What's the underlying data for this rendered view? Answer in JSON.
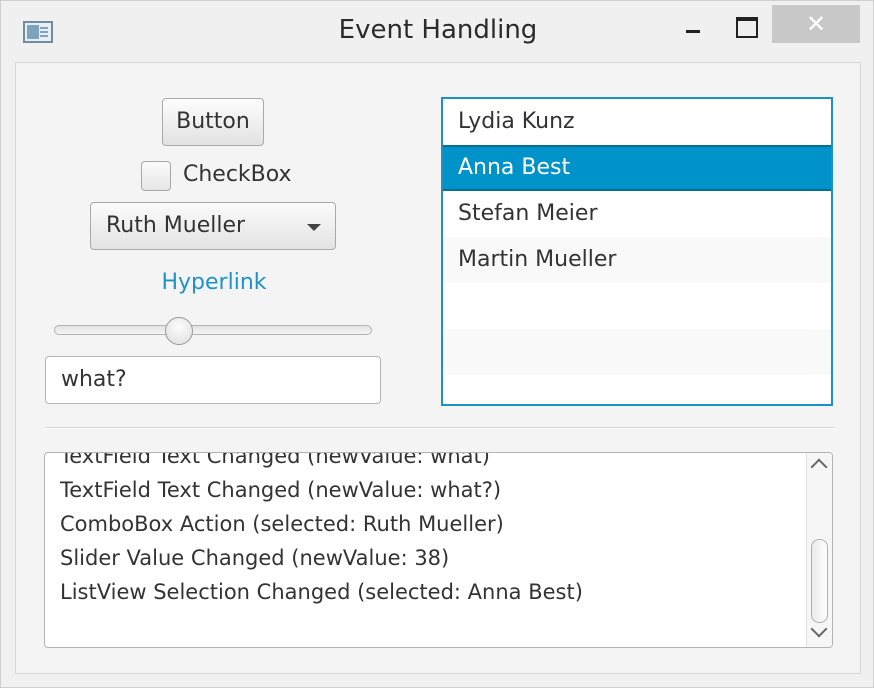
{
  "window": {
    "title": "Event Handling",
    "icon": "app-window-icon",
    "close_glyph": "✕"
  },
  "controls": {
    "button_label": "Button",
    "checkbox_label": "CheckBox",
    "checkbox_checked": false,
    "combo_value": "Ruth Mueller",
    "hyperlink_label": "Hyperlink",
    "slider_value": 38,
    "slider_min": 0,
    "slider_max": 100,
    "textfield_value": "what?"
  },
  "listview": {
    "items": [
      "Lydia Kunz",
      "Anna Best",
      "Stefan Meier",
      "Martin Mueller"
    ],
    "selected_index": 1
  },
  "log": {
    "lines": [
      "TextField Text Changed (newValue: what)",
      "TextField Text Changed (newValue: what?)",
      "ComboBox Action (selected: Ruth Mueller)",
      "Slider Value Changed (newValue: 38)",
      "ListView Selection Changed (selected: Anna Best)"
    ]
  },
  "colors": {
    "accent": "#0093c9",
    "hyperlink": "#1f93c7",
    "focus_border": "#1a92c4"
  }
}
